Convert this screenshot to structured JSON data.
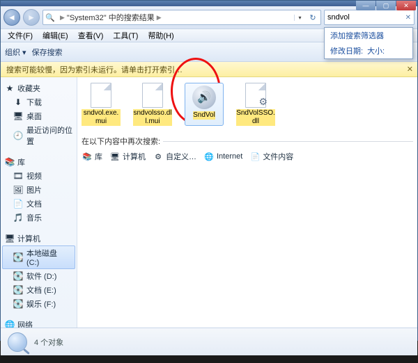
{
  "window": {
    "min": "—",
    "max": "▢",
    "close": "✕"
  },
  "address": {
    "crumb1": "\"System32\" 中的搜索结果",
    "sep": "▶"
  },
  "search": {
    "value": "sndvol"
  },
  "filter_popup": {
    "title": "添加搜索筛选器",
    "row_label": "修改日期:",
    "row_link": "大小:"
  },
  "menu": {
    "file": "文件(F)",
    "edit": "编辑(E)",
    "view": "查看(V)",
    "tools": "工具(T)",
    "help": "帮助(H)"
  },
  "toolbar": {
    "organize": "组织 ▾",
    "save_search": "保存搜索"
  },
  "infobar": {
    "text": "搜索可能较慢，因为索引未运行。请单击打开索引…"
  },
  "sidebar": {
    "fav_head": "收藏夹",
    "fav": [
      "下载",
      "桌面",
      "最近访问的位置"
    ],
    "lib_head": "库",
    "lib": [
      "视频",
      "图片",
      "文档",
      "音乐"
    ],
    "comp_head": "计算机",
    "comp": [
      "本地磁盘 (C:)",
      "软件 (D:)",
      "文档 (E:)",
      "娱乐 (F:)"
    ],
    "net_head": "网络"
  },
  "files": [
    {
      "name": "sndvol.exe.mui",
      "type": "page"
    },
    {
      "name": "sndvolsso.dll.mui",
      "type": "page"
    },
    {
      "name": "SndVol",
      "type": "speaker",
      "selected": true
    },
    {
      "name": "SndVolSSO.dll",
      "type": "page-gear"
    }
  ],
  "again_label": "在以下内容中再次搜索:",
  "sub": [
    {
      "icon": "📚",
      "label": "库"
    },
    {
      "icon": "🖥",
      "label": "计算机"
    },
    {
      "icon": "⚙",
      "label": "自定义…"
    },
    {
      "icon": "🌐",
      "label": "Internet"
    },
    {
      "icon": "📄",
      "label": "文件内容"
    }
  ],
  "status": {
    "count": "4 个对象"
  }
}
